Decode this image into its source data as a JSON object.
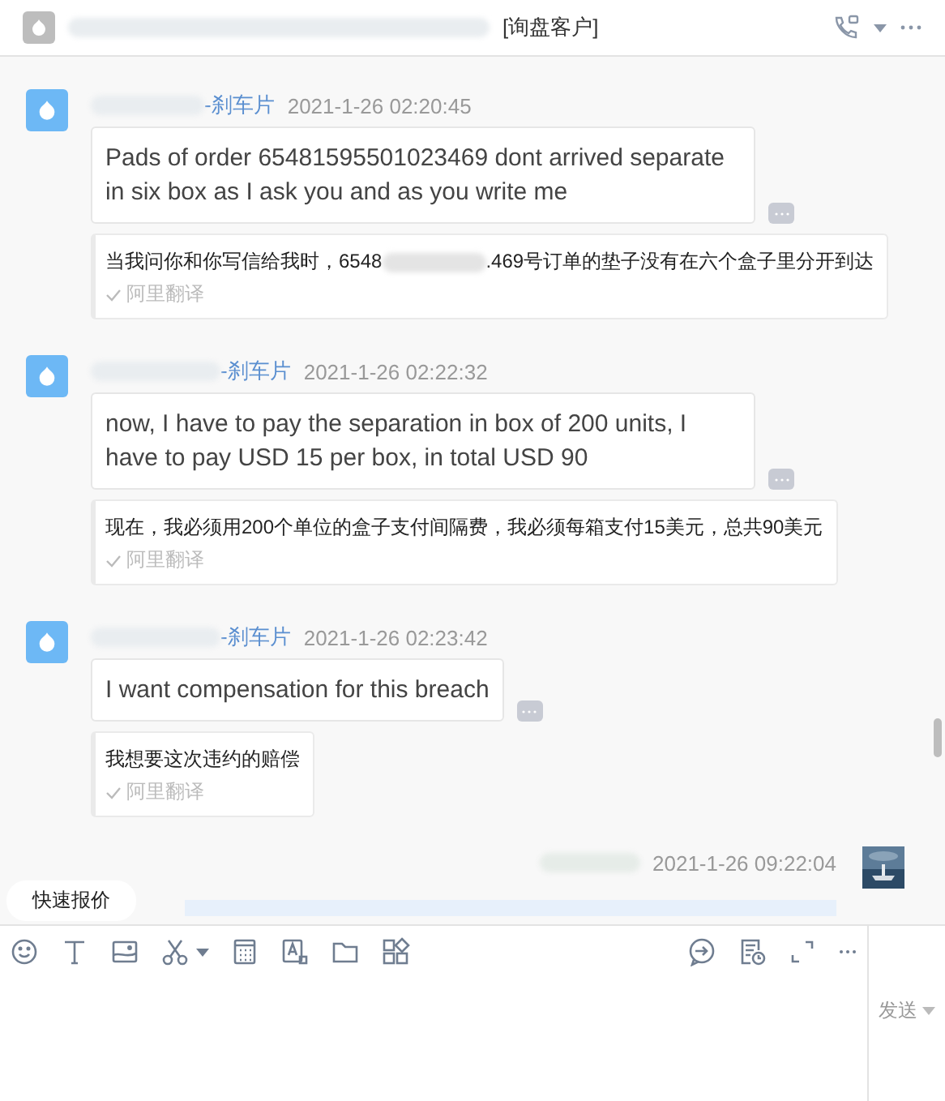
{
  "header": {
    "tag": "[询盘客户]"
  },
  "messages": [
    {
      "kind": "incoming",
      "sender": "-刹车片",
      "time": "2021-1-26 02:20:45",
      "text": "Pads of order 65481595501023469 dont arrived separate in six box as I ask you and as you write me",
      "translation": {
        "before": "当我问你和你写信给我时，6548",
        "redacted": true,
        "after": ".469号订单的垫子没有在六个盒子里分开到达",
        "source": "阿里翻译"
      }
    },
    {
      "kind": "incoming",
      "sender": "-刹车片",
      "time": "2021-1-26 02:22:32",
      "text": "now, I have to pay the separation in box of 200 units, I have to pay USD 15 per box, in total USD 90",
      "translation": {
        "before": "现在，我必须用200个单位的盒子支付间隔费，我必须每箱支付15美元，总共90美元",
        "redacted": false,
        "source": "阿里翻译"
      }
    },
    {
      "kind": "incoming",
      "sender": "-刹车片",
      "time": "2021-1-26 02:23:42",
      "text": "I want compensation for this breach",
      "translation": {
        "before": "我想要这次违约的赔偿",
        "redacted": false,
        "source": "阿里翻译"
      }
    },
    {
      "kind": "outgoing",
      "time": "2021-1-26 09:22:04"
    }
  ],
  "quick_reply": "快速报价",
  "send_button": "发送"
}
